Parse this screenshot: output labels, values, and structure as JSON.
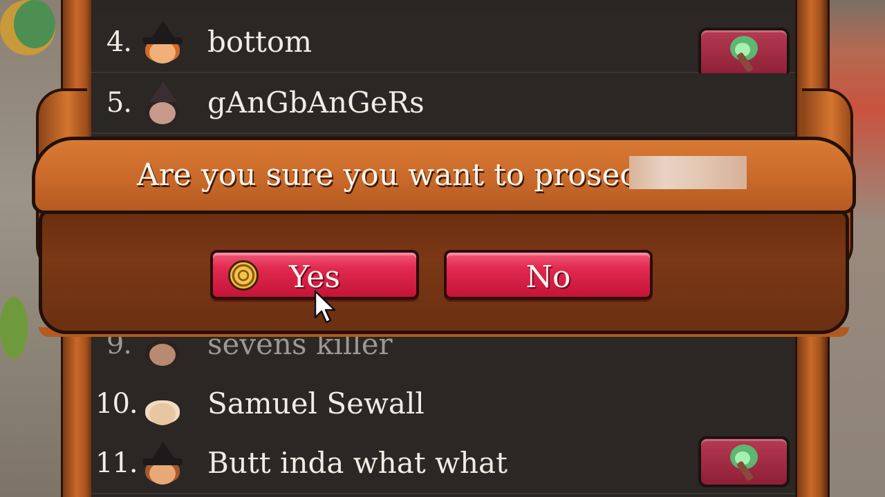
{
  "players_above": [
    {
      "number": "4.",
      "name": "bottom",
      "has_action": true
    },
    {
      "number": "5.",
      "name": "gAnGbAnGeRs",
      "has_action": false
    }
  ],
  "players_below": [
    {
      "number": "9.",
      "name": "sevens killer",
      "has_action": false
    },
    {
      "number": "10.",
      "name": "Samuel Sewall",
      "has_action": false
    },
    {
      "number": "11.",
      "name": "Butt inda what what",
      "has_action": true
    }
  ],
  "dialog": {
    "question": "Are you sure you want to prosecute",
    "yes_label": "Yes",
    "no_label": "No"
  },
  "colors": {
    "frame_wood": "#c9692a",
    "button_red": "#e2294f",
    "panel_dark": "#2a2624"
  },
  "icons": {
    "action": "torch-icon",
    "coin": "coin-icon",
    "cursor": "mouse-cursor-icon"
  }
}
